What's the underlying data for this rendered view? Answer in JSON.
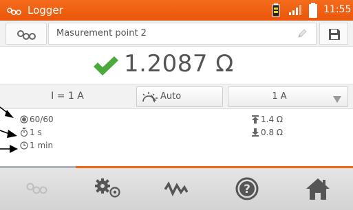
{
  "statusbar": {
    "title": "Logger",
    "time": "11:55",
    "icons": [
      "logger-icon",
      "meter-battery-icon",
      "signal-icon",
      "battery-icon"
    ]
  },
  "name_row": {
    "measurement_point": "Masurement point 2",
    "icons": [
      "logger-mode-icon",
      "pencil-icon",
      "save-icon"
    ]
  },
  "result": {
    "value": "1.2087 Ω",
    "status_icon": "check-icon"
  },
  "params": {
    "current_label": "I = 1 A",
    "auto_label": "Auto",
    "range_label": "1 A",
    "icons": [
      "auto-sun-icon",
      "dropdown-icon"
    ]
  },
  "info": {
    "count": "60/60",
    "interval": "1 s",
    "duration": "1 min",
    "upper_limit": "1.4 Ω",
    "lower_limit": "0.8 Ω",
    "icons": [
      "record-icon",
      "stopwatch-icon",
      "clock-icon",
      "upper-limit-icon",
      "lower-limit-icon",
      "arrow-icon"
    ]
  },
  "nav": {
    "icons": [
      "logger-nav-icon",
      "settings-gears-icon",
      "waveform-icon",
      "help-icon",
      "home-icon"
    ]
  },
  "colors": {
    "accent": "#ee6a1a",
    "check": "#4caa3c",
    "navbar": "#dcdcdc",
    "icon_dark": "#555555"
  }
}
